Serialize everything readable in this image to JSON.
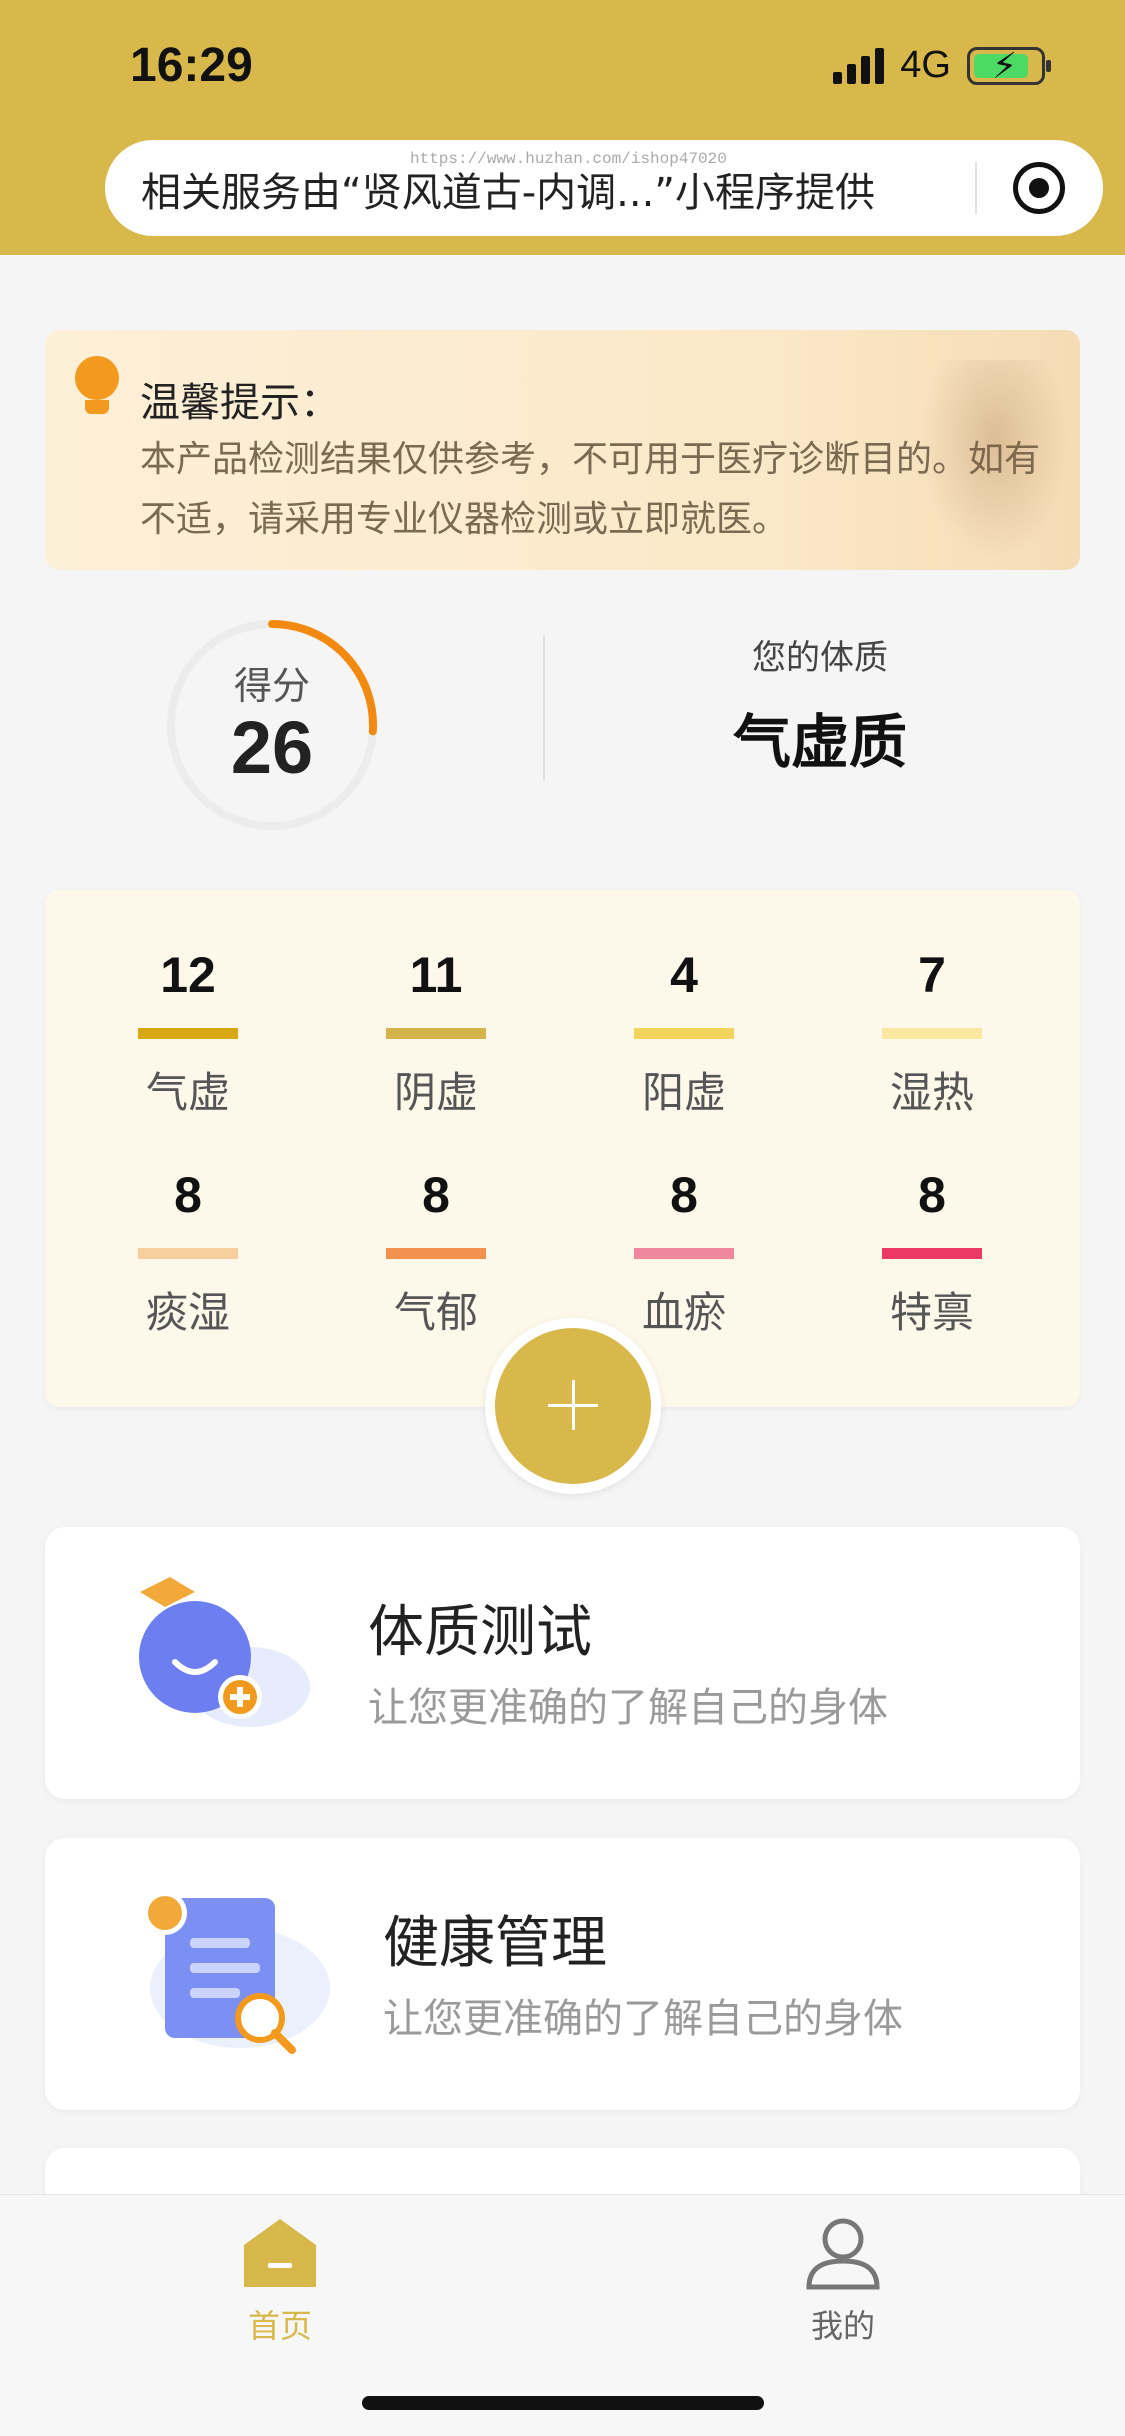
{
  "status": {
    "time": "16:29",
    "network": "4G"
  },
  "notice": {
    "text": "相关服务由“贤风道古-内调...”小程序提供",
    "watermark": "https://www.huzhan.com/ishop47020"
  },
  "tip": {
    "title": "温馨提示：",
    "body": "本产品检测结果仅供参考，不可用于医疗诊断目的。如有不适，请采用专业仪器检测或立即就医。"
  },
  "score": {
    "label": "得分",
    "value": "26",
    "progress_percent": 26
  },
  "constitution": {
    "label": "您的体质",
    "value": "气虚质"
  },
  "stats": [
    {
      "value": "12",
      "label": "气虚",
      "color": "#d7a714"
    },
    {
      "value": "11",
      "label": "阴虚",
      "color": "#d4b44a"
    },
    {
      "value": "4",
      "label": "阳虚",
      "color": "#f2d35c"
    },
    {
      "value": "7",
      "label": "湿热",
      "color": "#fae8a0"
    },
    {
      "value": "8",
      "label": "痰湿",
      "color": "#f8cf9c"
    },
    {
      "value": "8",
      "label": "气郁",
      "color": "#f2924e"
    },
    {
      "value": "8",
      "label": "血瘀",
      "color": "#f0879c"
    },
    {
      "value": "8",
      "label": "特禀",
      "color": "#ec3a67"
    }
  ],
  "features": [
    {
      "title": "体质测试",
      "subtitle": "让您更准确的了解自己的身体"
    },
    {
      "title": "健康管理",
      "subtitle": "让您更准确的了解自己的身体"
    }
  ],
  "tabs": [
    {
      "label": "首页",
      "active": true,
      "color": "#d8b84b"
    },
    {
      "label": "我的",
      "active": false,
      "color": "#666666"
    }
  ],
  "colors": {
    "brand": "#d8b84b",
    "accent_orange": "#f28a12"
  }
}
